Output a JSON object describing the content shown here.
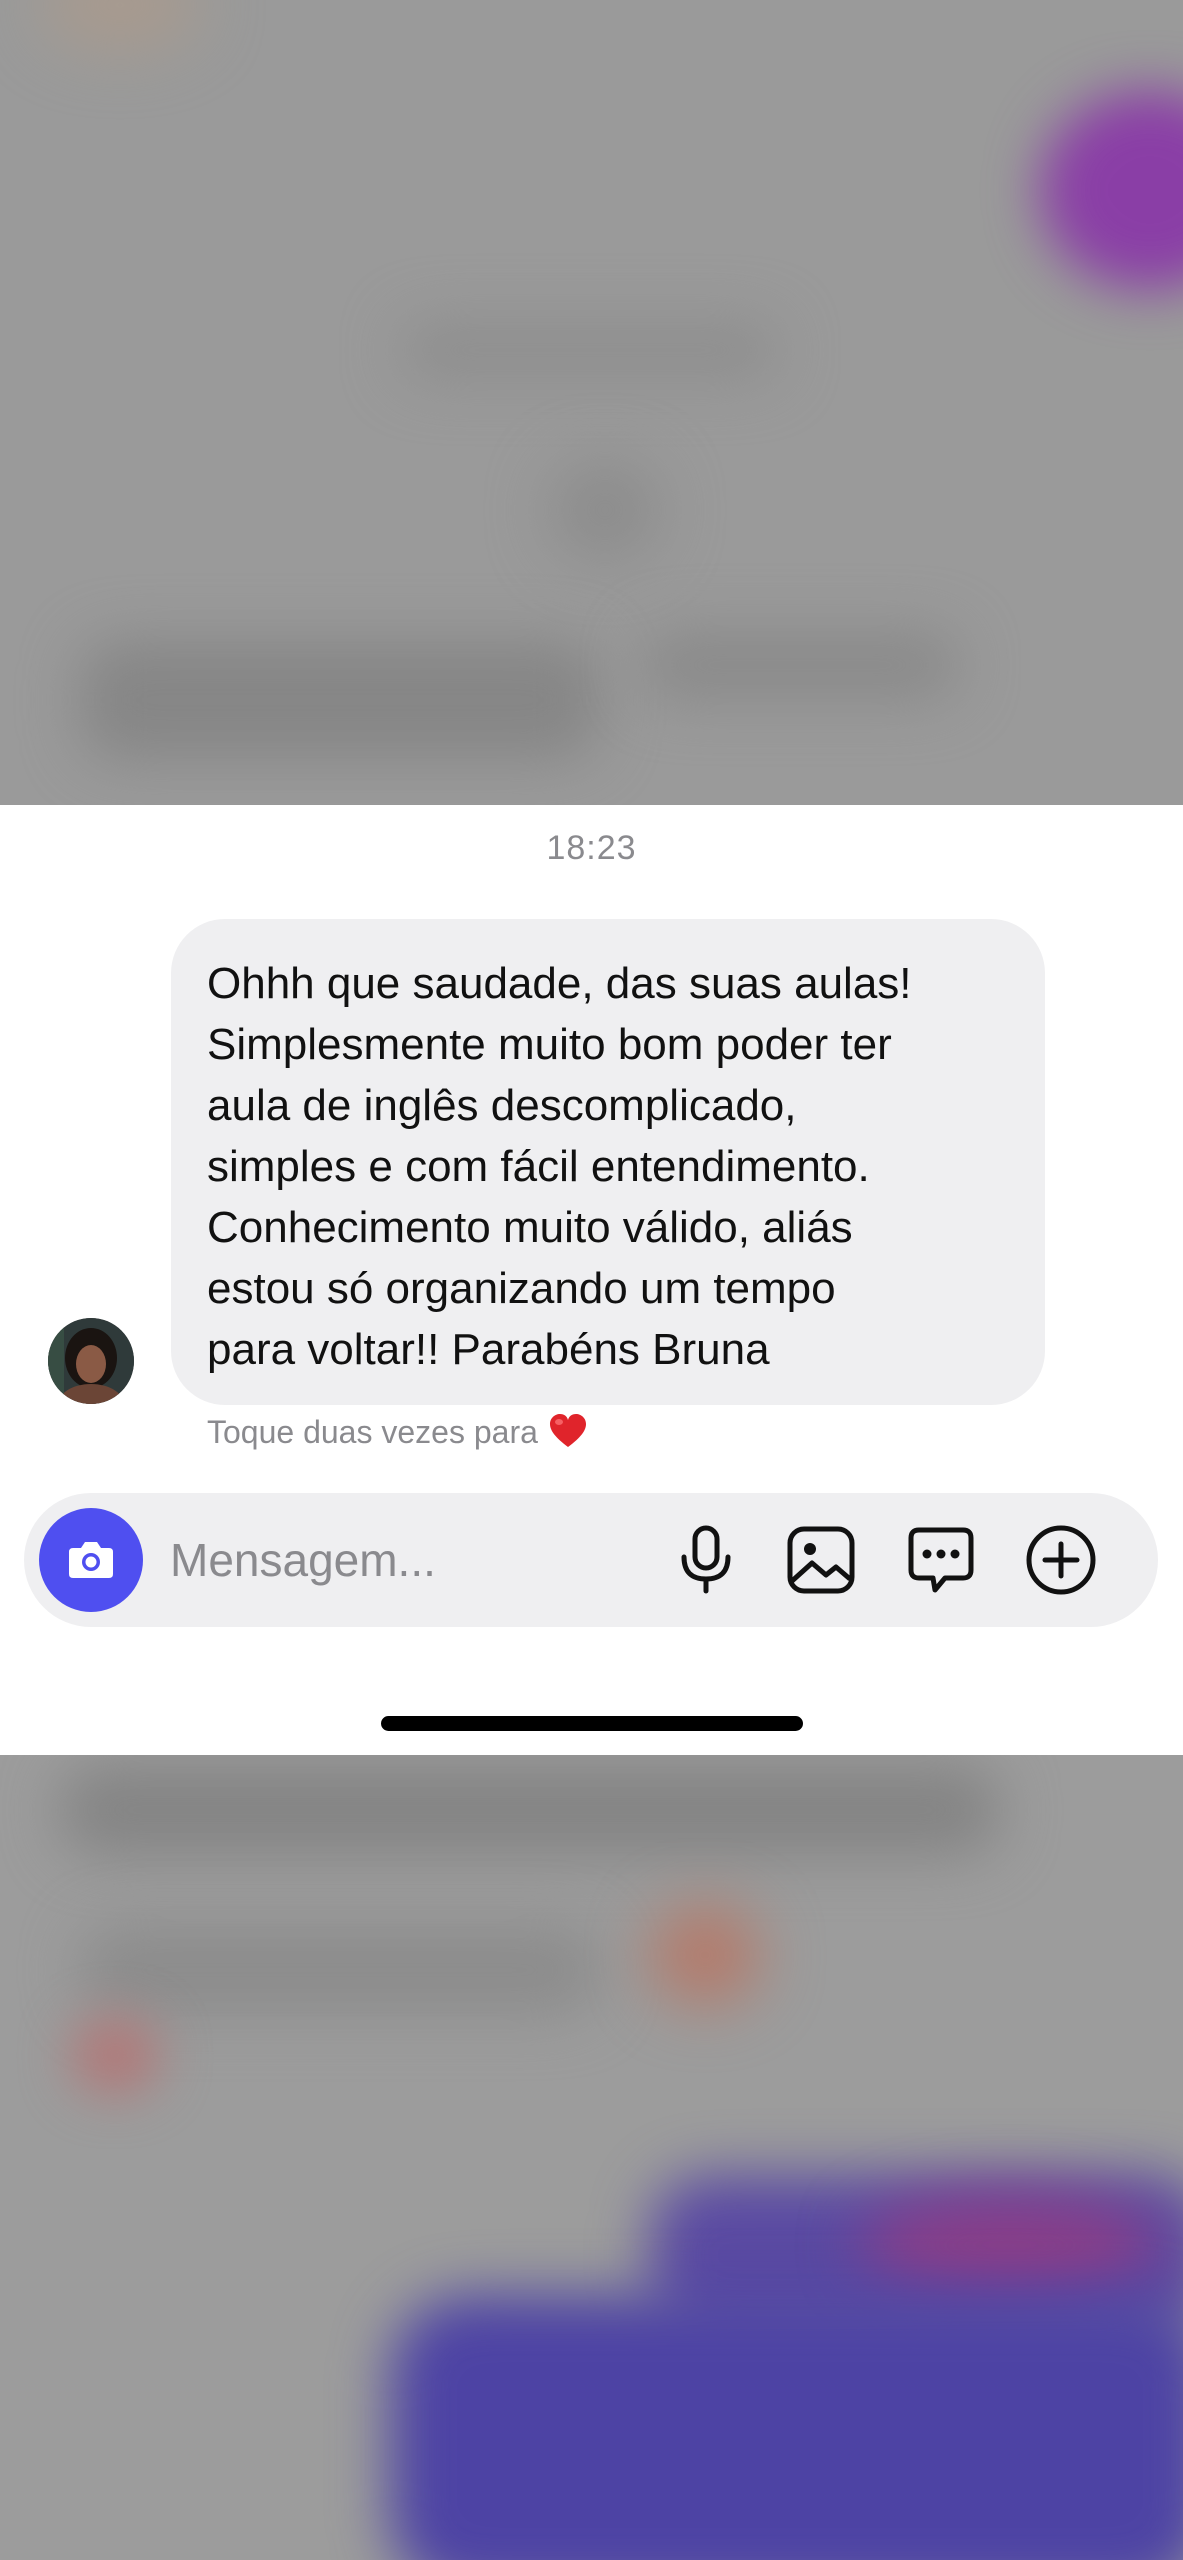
{
  "chat": {
    "timestamp": "18:23",
    "message": "Ohhh que saudade, das suas aulas!\nSimplesmente muito bom poder ter\naula de inglês  descomplicado,\nsimples e com fácil entendimento.\nConhecimento muito válido, aliás\nestou só organizando um tempo\npara voltar!! Parabéns Bruna",
    "reaction_hint": "Toque duas vezes para",
    "reaction_icon": "heart-icon"
  },
  "composer": {
    "placeholder": "Mensagem...",
    "camera_icon": "camera-icon",
    "icons": [
      "microphone-icon",
      "gallery-icon",
      "chat-bubble-icon",
      "plus-circle-icon"
    ],
    "accent_color": "#4f4ff0"
  },
  "colors": {
    "bubble": "#efeff1",
    "backdrop": "#9a9a9a",
    "heart": "#e0242b"
  }
}
